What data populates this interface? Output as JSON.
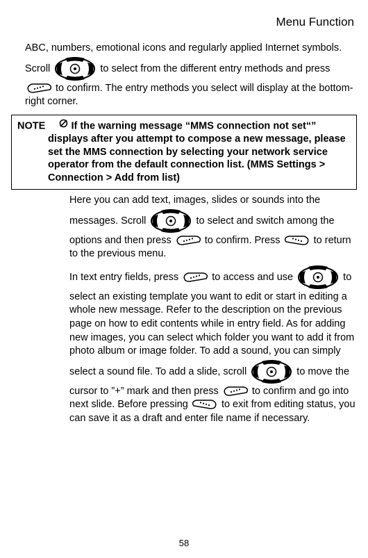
{
  "header": {
    "title": "Menu Function"
  },
  "p1": {
    "t1": "ABC, numbers, emotional icons and regularly applied Internet symbols. Scroll ",
    "t2": " to select from the different entry methods and press ",
    "t3": " to confirm. The entry methods you select will display at the bottom-right corner."
  },
  "note": {
    "label": "NOTE",
    "body_first": "If the warning message “MMS connection not set“”",
    "body_rest": "displays after you attempt to compose a new message, please set the MMS connection by selecting your network service operator from the default connection list. (MMS Settings > Connection > Add from list)"
  },
  "p2": {
    "t1": "Here you can add text, images, slides or sounds into the messages. Scroll ",
    "t2": " to select and switch among the options and then press ",
    "t3": " to confirm. Press ",
    "t4": " to return to the previous menu."
  },
  "p3": {
    "t1": "In text entry fields, press ",
    "t2": " to access and use ",
    "t3": " to select an existing template you want to edit or start in editing a whole new message. Refer to the description on the previous page on how to edit contents while in entry field. As for adding new images, you can select which folder you want to add it from photo album or image folder. To add a sound, you can simply select a sound file. To add a slide, scroll ",
    "t4": " to move the cursor to ”+” mark and then press ",
    "t5": "to confirm and go into next slide. Before pressing ",
    "t6": " to exit from editing status, you can save it as a draft and enter file name if necessary."
  },
  "page_number": "58"
}
